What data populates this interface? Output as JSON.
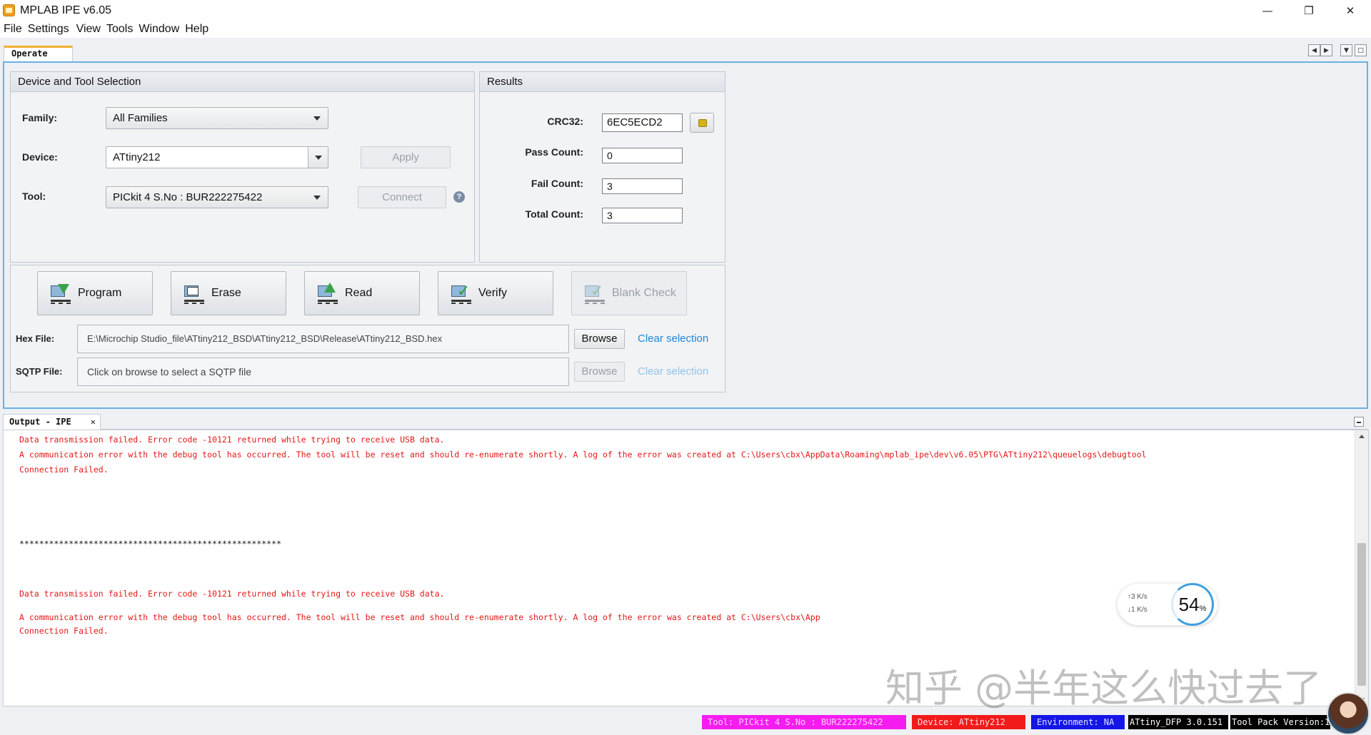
{
  "window": {
    "title": "MPLAB IPE v6.05",
    "minimize": "—",
    "maximize": "❐",
    "close": "✕"
  },
  "menu": [
    "File",
    "Settings",
    "View",
    "Tools",
    "Window",
    "Help"
  ],
  "tabs": {
    "operate": "Operate",
    "output": "Output - IPE"
  },
  "device_selection": {
    "title": "Device and Tool Selection",
    "family_label": "Family:",
    "family_value": "All Families",
    "device_label": "Device:",
    "device_value": "ATtiny212",
    "apply_label": "Apply",
    "tool_label": "Tool:",
    "tool_value": "PICkit 4 S.No : BUR222275422",
    "connect_label": "Connect",
    "help_icon": "?"
  },
  "results": {
    "title": "Results",
    "crc_label": "CRC32:",
    "crc_value": "6EC5ECD2",
    "pass_label": "Pass Count:",
    "pass_value": "0",
    "fail_label": "Fail Count:",
    "fail_value": "3",
    "total_label": "Total Count:",
    "total_value": "3"
  },
  "operations": {
    "program": "Program",
    "erase": "Erase",
    "read": "Read",
    "verify": "Verify",
    "blank_check": "Blank Check"
  },
  "files": {
    "hex_label": "Hex File:",
    "hex_value": "E:\\Microchip Studio_file\\ATtiny212_BSD\\ATtiny212_BSD\\Release\\ATtiny212_BSD.hex",
    "sqtp_label": "SQTP File:",
    "sqtp_placeholder": "Click on browse to select a SQTP file",
    "browse": "Browse",
    "clear": "Clear selection"
  },
  "output_lines": {
    "l1": "Data transmission failed. Error code -10121 returned while trying to receive USB data.",
    "l2": "A communication error with the debug tool has occurred. The tool will be reset and should re-enumerate shortly. A log of the error was created at C:\\Users\\cbx\\AppData\\Roaming\\mplab_ipe\\dev\\v6.05\\PTG\\ATtiny212\\queuelogs\\debugtool",
    "l3": "Connection Failed.",
    "l4": "*****************************************************",
    "l5": "Data transmission failed. Error code -10121 returned while trying to receive USB data.",
    "l6": "A communication error with the debug tool has occurred. The tool will be reset and should re-enumerate shortly. A log of the error was created at C:\\Users\\cbx\\App",
    "l7": "Connection Failed."
  },
  "net_widget": {
    "up": "↑3  K/s",
    "down": "↓1  K/s",
    "percent": "54",
    "percent_sign": "%"
  },
  "watermark": "知乎 @半年这么快过去了",
  "status": {
    "tool": "Tool: PICkit 4 S.No : BUR222275422",
    "device": "Device: ATtiny212",
    "environment": "Environment: NA",
    "dfp": "ATtiny_DFP 3.0.151",
    "toolpack": "Tool Pack Version:1",
    "colors": {
      "tool": "#f51cf0",
      "device": "#f21a1a",
      "environment": "#1515e8",
      "dfp": "#000000",
      "toolpack": "#000000"
    }
  },
  "colors": {
    "error_text": "#e21818",
    "link": "#1d86d8",
    "panel_border": "#6ab0e6"
  }
}
